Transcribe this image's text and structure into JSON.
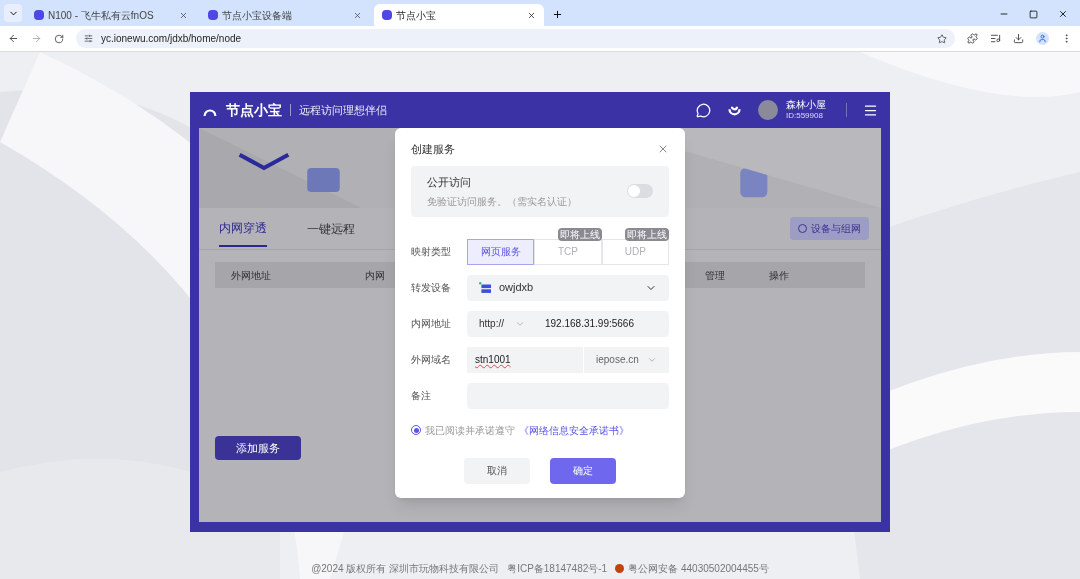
{
  "browser": {
    "tabs": [
      {
        "title": "N100 - 飞牛私有云fnOS",
        "selected": false
      },
      {
        "title": "节点小宝设备端",
        "selected": false
      },
      {
        "title": "节点小宝",
        "selected": true
      }
    ],
    "url": "yc.ionewu.com/jdxb/home/node"
  },
  "app": {
    "brand": "节点小宝",
    "slogan": "远程访问理想伴侣",
    "user": {
      "name": "森林小屋",
      "id": "ID:559908"
    },
    "tabs": [
      {
        "label": "内网穿透",
        "selected": true
      },
      {
        "label": "一键远程",
        "selected": false
      }
    ],
    "network_button": "设备与组网",
    "columns": [
      "外网地址",
      "内网",
      "管理",
      "操作"
    ],
    "add_button": "添加服务"
  },
  "dialog": {
    "title": "创建服务",
    "public_access": {
      "label": "公开访问",
      "hint": "免验证访问服务。（需实名认证）",
      "on": false
    },
    "mapping_type": {
      "label": "映射类型",
      "options": [
        {
          "label": "网页服务",
          "selected": true,
          "disabled": false
        },
        {
          "label": "TCP",
          "selected": false,
          "disabled": true,
          "badge": "即将上线"
        },
        {
          "label": "UDP",
          "selected": false,
          "disabled": true,
          "badge": "即将上线"
        }
      ]
    },
    "device": {
      "label": "转发设备",
      "value": "owjdxb"
    },
    "lan_address": {
      "label": "内网地址",
      "protocol": "http://",
      "value": "192.168.31.99:5666"
    },
    "domain": {
      "label": "外网域名",
      "value": "stn1001",
      "suffix": "iepose.cn"
    },
    "note": {
      "label": "备注"
    },
    "agreement": {
      "text": "我已阅读并承诺遵守",
      "link": "《网络信息安全承诺书》",
      "checked": true
    },
    "buttons": {
      "cancel": "取消",
      "ok": "确定"
    }
  },
  "footer": {
    "copyright": "@2024 版权所有 深圳市玩物科技有限公司",
    "icp": "粤ICP备18147482号-1",
    "police": "粤公网安备 44030502004455号"
  }
}
